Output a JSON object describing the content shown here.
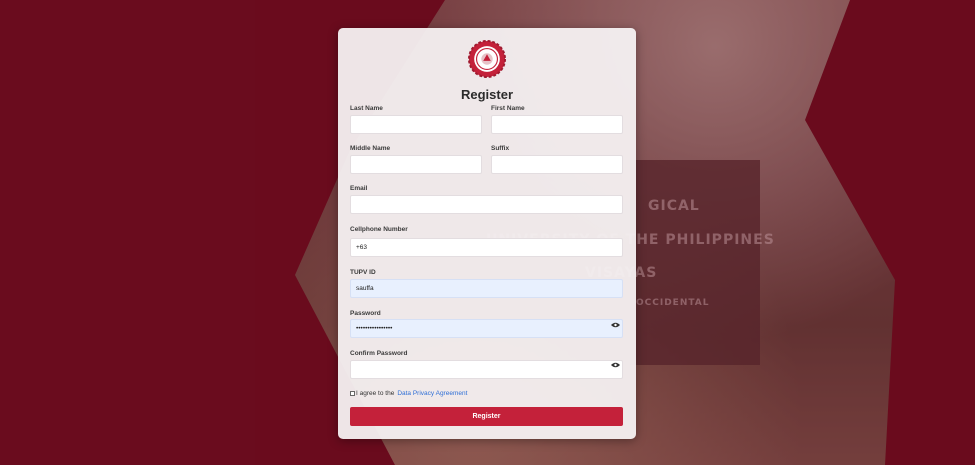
{
  "background": {
    "sign_lines": [
      "GICAL",
      "UNIVERSITY OF THE PHILIPPINES",
      "VISAYAS",
      "OCCIDENTAL"
    ]
  },
  "form": {
    "title": "Register",
    "fields": {
      "last_name": {
        "label": "Last Name",
        "value": ""
      },
      "first_name": {
        "label": "First Name",
        "value": ""
      },
      "middle_name": {
        "label": "Middle Name",
        "value": ""
      },
      "suffix": {
        "label": "Suffix",
        "value": ""
      },
      "email": {
        "label": "Email",
        "value": ""
      },
      "cellphone": {
        "label": "Cellphone Number",
        "value": "+63"
      },
      "tupv_id": {
        "label": "TUPV ID",
        "value": "sauffa"
      },
      "password": {
        "label": "Password",
        "value": "••••••••••••••••"
      },
      "confirm_password": {
        "label": "Confirm Password",
        "value": ""
      }
    },
    "agree_text": "I agree to the",
    "agree_link": "Data Privacy Agreement",
    "submit_label": "Register"
  },
  "colors": {
    "brand": "#6a0c1e",
    "button": "#c4213a",
    "link": "#2f6fd6"
  },
  "icons": {
    "logo": "university-seal-icon",
    "password_toggle": "eye-icon"
  }
}
